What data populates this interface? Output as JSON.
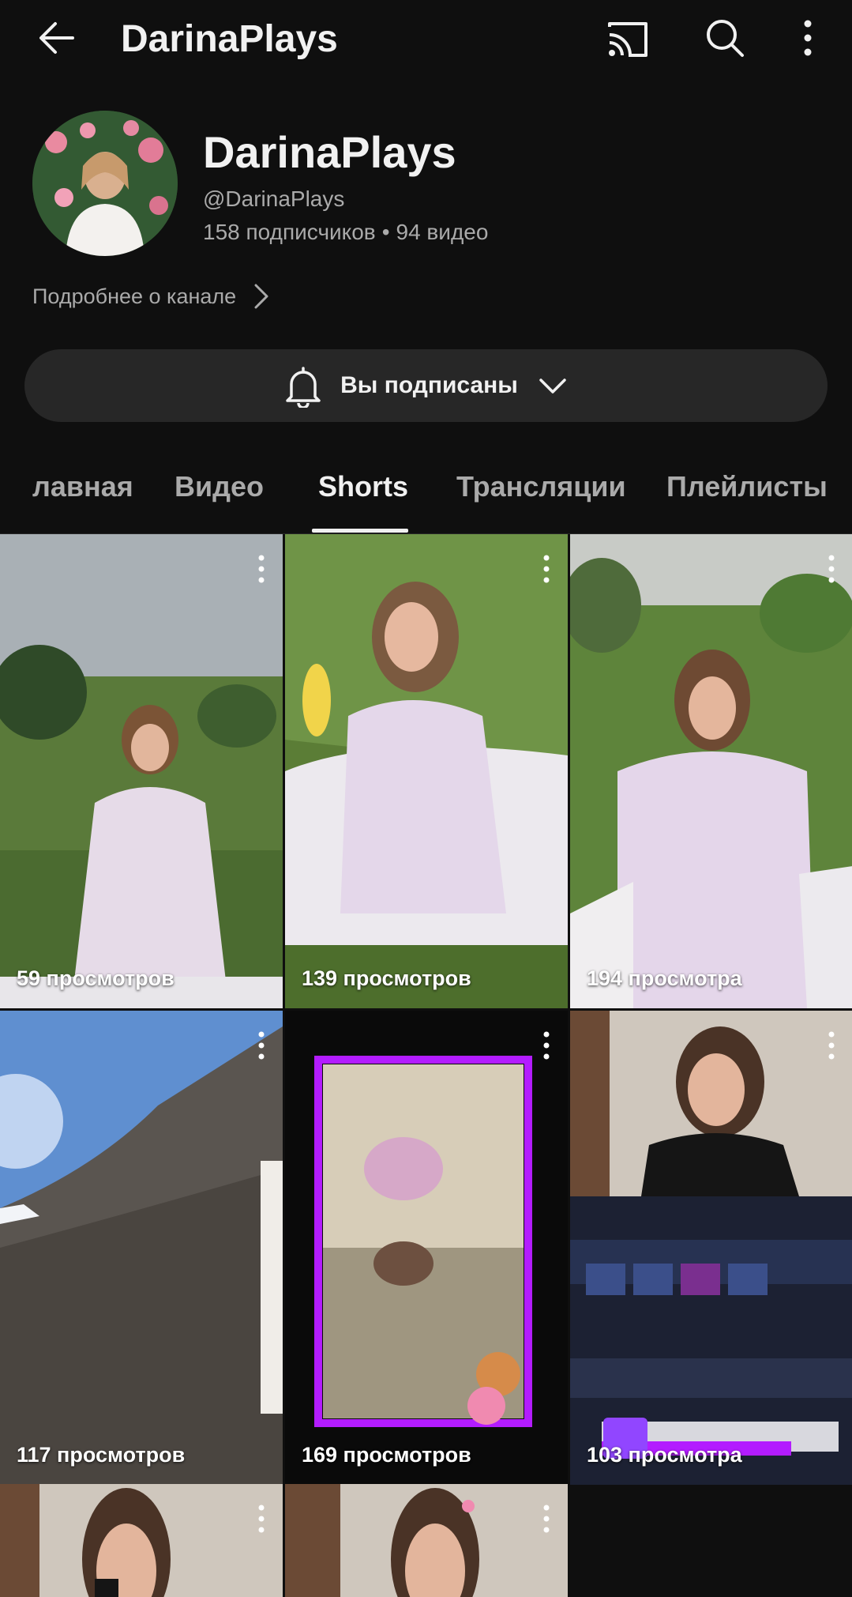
{
  "topbar": {
    "title": "DarinaPlays"
  },
  "channel": {
    "name": "DarinaPlays",
    "handle": "@DarinaPlays",
    "subscribers": "158 подписчиков",
    "separator": "•",
    "videos": "94 видео",
    "more_about": "Подробнее о канале"
  },
  "subscribe_button": {
    "label": "Вы подписаны"
  },
  "tabs": [
    {
      "label": "лавная"
    },
    {
      "label": "Видео"
    },
    {
      "label": "Shorts",
      "active": true
    },
    {
      "label": "Трансляции"
    },
    {
      "label": "Плейлисты"
    }
  ],
  "shorts": [
    {
      "views": "59 просмотров"
    },
    {
      "views": "139 просмотров"
    },
    {
      "views": "194 просмотра"
    },
    {
      "views": "117 просмотров"
    },
    {
      "views": "169 просмотров"
    },
    {
      "views": "103 просмотра"
    },
    {
      "views": ""
    },
    {
      "views": ""
    }
  ],
  "colors": {
    "background": "#0f0f0f",
    "button_bg": "#272727",
    "secondary_text": "#aaaaaa",
    "accent_purple": "#b31cff"
  }
}
